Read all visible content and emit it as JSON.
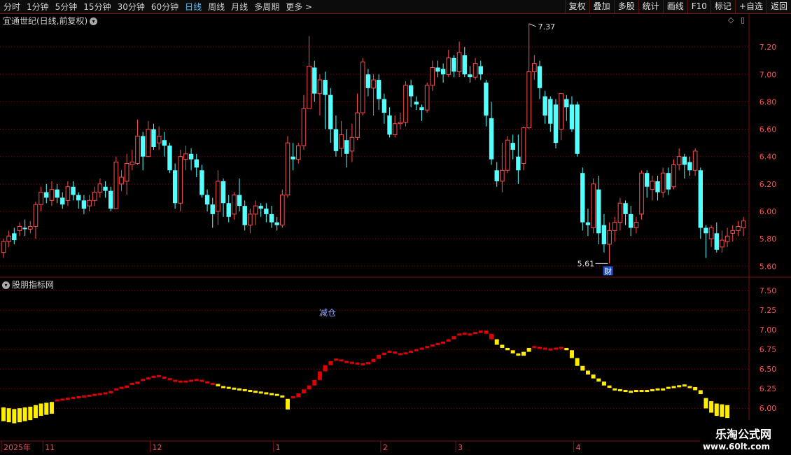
{
  "toolbar": {
    "periods": [
      "分时",
      "1分钟",
      "5分钟",
      "15分钟",
      "30分钟",
      "60分钟",
      "日线",
      "周线",
      "月线",
      "多周期",
      "更多"
    ],
    "active_period": "日线",
    "more_arrow": ">",
    "right_buttons": [
      "复权",
      "叠加",
      "多股",
      "统计",
      "画线",
      "F10",
      "标记",
      "+自选",
      "返回"
    ]
  },
  "main_panel": {
    "title": "宜通世纪(日线,前复权)",
    "right_icons": [
      "diamond-icon",
      "window-icon"
    ],
    "high_label": "7.37",
    "low_label": "5.61",
    "badge": "财"
  },
  "indicator_panel": {
    "title": "股朋指标网",
    "signal_text": "减仓"
  },
  "x_axis": {
    "labels": [
      {
        "text": "2025年",
        "index": 0
      },
      {
        "text": "11",
        "index": 8
      },
      {
        "text": "12",
        "index": 28
      },
      {
        "text": "1",
        "index": 51
      },
      {
        "text": "2",
        "index": 71
      },
      {
        "text": "3",
        "index": 85
      },
      {
        "text": "4",
        "index": 107
      }
    ]
  },
  "watermark": {
    "line1": "乐淘公式网",
    "line2": "www.60lt.com"
  },
  "colors": {
    "up": "#ff4d4d",
    "down": "#54ffff",
    "grid": "#7a1010",
    "axis_text": "#ff5050",
    "ind_up": "#e00000",
    "ind_down": "#ffee00"
  },
  "chart_data": [
    {
      "type": "candlestick",
      "title": "宜通世纪(日线,前复权)",
      "y_ticks": [
        5.6,
        5.8,
        6.0,
        6.2,
        6.4,
        6.6,
        6.8,
        7.0,
        7.2
      ],
      "ylim": [
        5.54,
        7.4
      ],
      "candles": [
        [
          5.7,
          5.78,
          5.66,
          5.8
        ],
        [
          5.78,
          5.82,
          5.74,
          5.86
        ],
        [
          5.84,
          5.79,
          5.76,
          5.88
        ],
        [
          5.86,
          5.89,
          5.82,
          5.92
        ],
        [
          5.88,
          5.87,
          5.82,
          5.94
        ],
        [
          5.87,
          5.89,
          5.84,
          5.93
        ],
        [
          5.89,
          6.05,
          5.8,
          6.07
        ],
        [
          6.05,
          6.14,
          6.0,
          6.18
        ],
        [
          6.14,
          6.1,
          6.06,
          6.2
        ],
        [
          6.08,
          6.16,
          6.04,
          6.22
        ],
        [
          6.16,
          6.1,
          6.06,
          6.2
        ],
        [
          6.1,
          6.05,
          6.02,
          6.14
        ],
        [
          6.08,
          6.18,
          6.04,
          6.22
        ],
        [
          6.18,
          6.12,
          6.08,
          6.22
        ],
        [
          6.12,
          6.08,
          6.02,
          6.14
        ],
        [
          6.08,
          6.02,
          5.98,
          6.12
        ],
        [
          6.04,
          6.08,
          6.0,
          6.12
        ],
        [
          6.08,
          6.14,
          6.04,
          6.18
        ],
        [
          6.14,
          6.2,
          6.1,
          6.24
        ],
        [
          6.18,
          6.15,
          6.1,
          6.22
        ],
        [
          6.15,
          6.02,
          6.0,
          6.18
        ],
        [
          6.02,
          6.36,
          6.02,
          6.4
        ],
        [
          6.2,
          6.25,
          6.15,
          6.3
        ],
        [
          6.22,
          6.35,
          6.12,
          6.42
        ],
        [
          6.34,
          6.36,
          6.3,
          6.45
        ],
        [
          6.35,
          6.55,
          6.34,
          6.67
        ],
        [
          6.55,
          6.4,
          6.3,
          6.58
        ],
        [
          6.4,
          6.6,
          6.4,
          6.66
        ],
        [
          6.6,
          6.47,
          6.45,
          6.64
        ],
        [
          6.5,
          6.55,
          6.45,
          6.62
        ],
        [
          6.52,
          6.48,
          6.4,
          6.58
        ],
        [
          6.48,
          6.3,
          6.28,
          6.5
        ],
        [
          6.3,
          6.06,
          6.02,
          6.35
        ],
        [
          6.06,
          6.4,
          6.0,
          6.45
        ],
        [
          6.38,
          6.42,
          6.3,
          6.48
        ],
        [
          6.42,
          6.38,
          6.3,
          6.46
        ],
        [
          6.38,
          6.32,
          6.25,
          6.42
        ],
        [
          6.3,
          6.12,
          6.1,
          6.34
        ],
        [
          6.12,
          6.05,
          6.0,
          6.16
        ],
        [
          6.05,
          5.98,
          5.88,
          6.1
        ],
        [
          6.0,
          6.22,
          5.9,
          6.3
        ],
        [
          6.22,
          6.06,
          5.96,
          6.24
        ],
        [
          6.06,
          5.96,
          5.92,
          6.12
        ],
        [
          5.98,
          6.12,
          5.94,
          6.14
        ],
        [
          6.12,
          6.04,
          6.0,
          6.24
        ],
        [
          6.04,
          5.9,
          5.86,
          6.08
        ],
        [
          5.9,
          5.98,
          5.84,
          6.02
        ],
        [
          5.98,
          6.04,
          5.9,
          6.08
        ],
        [
          6.04,
          6.02,
          5.96,
          6.06
        ],
        [
          6.02,
          5.98,
          5.92,
          6.06
        ],
        [
          5.98,
          5.92,
          5.88,
          6.04
        ],
        [
          5.92,
          5.9,
          5.86,
          5.96
        ],
        [
          5.9,
          6.12,
          5.88,
          6.16
        ],
        [
          6.12,
          6.5,
          6.1,
          6.55
        ],
        [
          6.4,
          6.38,
          6.3,
          6.5
        ],
        [
          6.38,
          6.48,
          6.35,
          6.5
        ],
        [
          6.48,
          6.75,
          6.45,
          6.85
        ],
        [
          6.75,
          7.06,
          6.75,
          7.28
        ],
        [
          7.05,
          6.86,
          6.8,
          7.1
        ],
        [
          6.86,
          6.96,
          6.7,
          7.0
        ],
        [
          6.96,
          6.85,
          6.6,
          7.02
        ],
        [
          6.85,
          6.6,
          6.5,
          6.9
        ],
        [
          6.6,
          6.44,
          6.4,
          6.7
        ],
        [
          6.46,
          6.56,
          6.4,
          6.66
        ],
        [
          6.52,
          6.42,
          6.32,
          6.6
        ],
        [
          6.44,
          6.54,
          6.36,
          6.64
        ],
        [
          6.54,
          6.72,
          6.52,
          6.86
        ],
        [
          6.72,
          7.09,
          6.7,
          7.12
        ],
        [
          7.0,
          6.9,
          6.84,
          7.04
        ],
        [
          6.9,
          6.96,
          6.7,
          7.0
        ],
        [
          6.96,
          6.82,
          6.74,
          7.0
        ],
        [
          6.82,
          6.72,
          6.64,
          6.86
        ],
        [
          6.7,
          6.56,
          6.54,
          6.76
        ],
        [
          6.56,
          6.64,
          6.54,
          6.7
        ],
        [
          6.64,
          6.65,
          6.6,
          6.72
        ],
        [
          6.65,
          6.92,
          6.62,
          6.95
        ],
        [
          6.92,
          6.84,
          6.76,
          6.96
        ],
        [
          6.8,
          6.78,
          6.74,
          6.84
        ],
        [
          6.76,
          6.74,
          6.66,
          6.78
        ],
        [
          6.74,
          6.92,
          6.72,
          6.94
        ],
        [
          6.92,
          7.05,
          6.88,
          7.1
        ],
        [
          7.05,
          7.02,
          6.98,
          7.1
        ],
        [
          7.04,
          7.0,
          6.94,
          7.08
        ],
        [
          7.0,
          7.12,
          6.98,
          7.18
        ],
        [
          7.12,
          7.02,
          6.98,
          7.14
        ],
        [
          7.02,
          7.16,
          6.98,
          7.24
        ],
        [
          7.14,
          7.0,
          6.98,
          7.2
        ],
        [
          7.0,
          6.98,
          6.94,
          7.06
        ],
        [
          6.98,
          7.08,
          6.96,
          7.12
        ],
        [
          7.06,
          7.0,
          6.96,
          7.1
        ],
        [
          6.94,
          6.7,
          6.62,
          6.96
        ],
        [
          6.68,
          6.38,
          6.34,
          6.8
        ],
        [
          6.3,
          6.22,
          6.18,
          6.36
        ],
        [
          6.22,
          6.3,
          6.14,
          6.5
        ],
        [
          6.3,
          6.52,
          6.28,
          6.55
        ],
        [
          6.5,
          6.45,
          6.38,
          6.56
        ],
        [
          6.4,
          6.3,
          6.2,
          6.56
        ],
        [
          6.35,
          6.61,
          6.3,
          6.62
        ],
        [
          6.61,
          7.02,
          6.6,
          7.37
        ],
        [
          7.02,
          7.08,
          6.96,
          7.14
        ],
        [
          7.06,
          6.9,
          6.82,
          7.1
        ],
        [
          6.84,
          6.7,
          6.64,
          6.88
        ],
        [
          6.82,
          6.64,
          6.58,
          6.84
        ],
        [
          6.78,
          6.5,
          6.46,
          6.82
        ],
        [
          6.6,
          6.86,
          6.52,
          6.86
        ],
        [
          6.82,
          6.76,
          6.66,
          6.85
        ],
        [
          6.78,
          6.6,
          6.58,
          6.84
        ],
        [
          6.78,
          6.42,
          6.4,
          6.8
        ],
        [
          6.28,
          5.92,
          5.86,
          6.32
        ],
        [
          5.92,
          5.9,
          5.82,
          6.02
        ],
        [
          5.88,
          6.2,
          5.84,
          6.24
        ],
        [
          6.16,
          5.84,
          5.76,
          6.26
        ],
        [
          5.9,
          5.76,
          5.7,
          5.98
        ],
        [
          5.76,
          5.86,
          5.62,
          5.92
        ],
        [
          5.86,
          5.92,
          5.78,
          5.96
        ],
        [
          5.92,
          6.06,
          5.86,
          6.1
        ],
        [
          6.06,
          5.98,
          5.9,
          6.08
        ],
        [
          5.98,
          5.88,
          5.82,
          6.04
        ],
        [
          5.88,
          5.92,
          5.84,
          5.96
        ],
        [
          5.98,
          6.28,
          5.94,
          6.3
        ],
        [
          6.28,
          6.18,
          6.1,
          6.3
        ],
        [
          6.16,
          6.22,
          6.08,
          6.26
        ],
        [
          6.22,
          6.14,
          6.08,
          6.26
        ],
        [
          6.14,
          6.28,
          6.1,
          6.32
        ],
        [
          6.28,
          6.16,
          6.12,
          6.32
        ],
        [
          6.18,
          6.34,
          6.16,
          6.38
        ],
        [
          6.34,
          6.4,
          6.3,
          6.46
        ],
        [
          6.4,
          6.34,
          6.24,
          6.42
        ],
        [
          6.36,
          6.3,
          6.26,
          6.4
        ],
        [
          6.3,
          6.44,
          6.26,
          6.46
        ],
        [
          6.3,
          5.88,
          5.8,
          6.32
        ],
        [
          5.88,
          5.84,
          5.66,
          5.9
        ],
        [
          5.8,
          5.88,
          5.74,
          5.9
        ],
        [
          5.84,
          5.72,
          5.7,
          5.92
        ],
        [
          5.74,
          5.79,
          5.7,
          5.86
        ],
        [
          5.78,
          5.82,
          5.74,
          5.88
        ],
        [
          5.84,
          5.86,
          5.78,
          5.9
        ],
        [
          5.86,
          5.89,
          5.82,
          5.93
        ],
        [
          5.88,
          5.93,
          5.82,
          5.96
        ]
      ]
    },
    {
      "type": "bar",
      "title": "股朋指标网",
      "y_ticks": [
        6.0,
        6.25,
        6.5,
        6.75,
        7.0,
        7.25,
        7.5
      ],
      "ylim": [
        5.85,
        7.6
      ],
      "values": [
        6.01,
        6.0,
        5.99,
        6.0,
        6.01,
        6.02,
        6.04,
        6.06,
        6.07,
        6.08,
        6.1,
        6.11,
        6.12,
        6.13,
        6.14,
        6.15,
        6.16,
        6.17,
        6.18,
        6.19,
        6.22,
        6.24,
        6.26,
        6.29,
        6.31,
        6.34,
        6.36,
        6.38,
        6.4,
        6.41,
        6.39,
        6.37,
        6.35,
        6.34,
        6.34,
        6.35,
        6.36,
        6.35,
        6.33,
        6.31,
        6.28,
        6.27,
        6.26,
        6.25,
        6.24,
        6.23,
        6.22,
        6.21,
        6.2,
        6.19,
        6.18,
        6.17,
        6.15,
        6.12,
        6.14,
        6.19,
        6.24,
        6.29,
        6.36,
        6.47,
        6.55,
        6.6,
        6.62,
        6.61,
        6.59,
        6.58,
        6.57,
        6.56,
        6.59,
        6.63,
        6.68,
        6.71,
        6.72,
        6.71,
        6.69,
        6.7,
        6.72,
        6.74,
        6.76,
        6.78,
        6.8,
        6.82,
        6.85,
        6.88,
        6.92,
        6.94,
        6.95,
        6.94,
        6.96,
        6.99,
        6.95,
        6.88,
        6.81,
        6.77,
        6.74,
        6.7,
        6.67,
        6.72,
        6.77,
        6.78,
        6.77,
        6.76,
        6.75,
        6.76,
        6.77,
        6.74,
        6.64,
        6.54,
        6.48,
        6.43,
        6.38,
        6.34,
        6.29,
        6.26,
        6.24,
        6.23,
        6.22,
        6.21,
        6.22,
        6.22,
        6.22,
        6.23,
        6.24,
        6.24,
        6.26,
        6.27,
        6.28,
        6.29,
        6.27,
        6.23,
        6.18,
        6.13,
        6.09,
        6.06,
        6.05,
        6.04
      ],
      "trend": [
        "down",
        "down",
        "down",
        "down",
        "down",
        "down",
        "down",
        "down",
        "down",
        "down",
        "up",
        "up",
        "up",
        "up",
        "up",
        "up",
        "up",
        "up",
        "up",
        "up",
        "up",
        "up",
        "up",
        "up",
        "up",
        "up",
        "up",
        "up",
        "up",
        "up",
        "up",
        "up",
        "up",
        "up",
        "up",
        "up",
        "up",
        "up",
        "up",
        "up",
        "down",
        "down",
        "down",
        "down",
        "down",
        "down",
        "down",
        "down",
        "down",
        "down",
        "down",
        "down",
        "down",
        "down",
        "up",
        "up",
        "up",
        "up",
        "up",
        "up",
        "up",
        "up",
        "up",
        "up",
        "up",
        "up",
        "up",
        "up",
        "up",
        "up",
        "up",
        "up",
        "up",
        "up",
        "up",
        "up",
        "up",
        "up",
        "up",
        "up",
        "up",
        "up",
        "up",
        "up",
        "up",
        "up",
        "up",
        "up",
        "up",
        "up",
        "up",
        "up",
        "down",
        "down",
        "down",
        "down",
        "down",
        "down",
        "down",
        "up",
        "up",
        "up",
        "up",
        "up",
        "up",
        "down",
        "down",
        "down",
        "down",
        "down",
        "down",
        "down",
        "down",
        "down",
        "down",
        "down",
        "down",
        "down",
        "down",
        "down",
        "down",
        "down",
        "down",
        "down",
        "down",
        "down",
        "down",
        "down",
        "down",
        "down",
        "down",
        "down",
        "down",
        "down",
        "down",
        "down"
      ]
    }
  ]
}
